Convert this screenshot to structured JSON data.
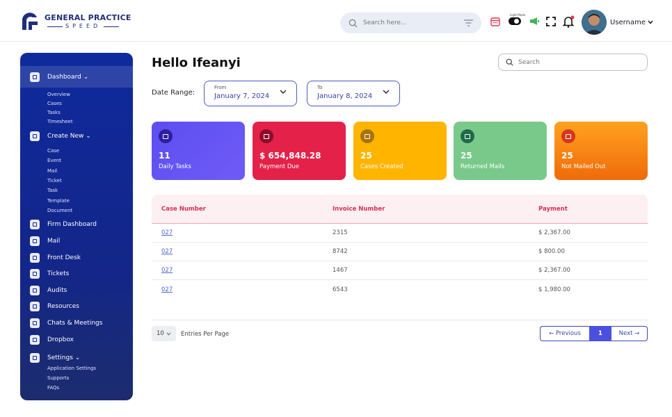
{
  "header": {
    "brand_name": "GENERAL PRACTICE",
    "brand_sub": "SPEED",
    "search_placeholder": "Search here...",
    "theme_label": "Light Mode",
    "username": "Username"
  },
  "sidebar": {
    "dashboard": "Dashboard ⌄",
    "dashboard_sub": [
      "Overview",
      "Cases",
      "Tasks",
      "Timesheet"
    ],
    "create_new": "Create New ⌄",
    "create_sub": [
      "Case",
      "Event",
      "Mail",
      "Ticket",
      "Task",
      "Template",
      "Document"
    ],
    "items": [
      "Firm Dashboard",
      "Mail",
      "Front Desk",
      "Tickets",
      "Audits",
      "Resources",
      "Chats & Meetings",
      "Dropbox"
    ],
    "settings": "Settings ⌄",
    "settings_sub": [
      "Application Settings",
      "Supports",
      "FAQs"
    ]
  },
  "main": {
    "title": "Hello Ifeanyi",
    "search_placeholder": "Search",
    "date_range_label": "Date Range:",
    "from_label": "From",
    "from_value": "January 7, 2024",
    "to_label": "To",
    "to_value": "January 8, 2024"
  },
  "cards": [
    {
      "value": "11",
      "label": "Daily Tasks",
      "color": "#5b5bf0"
    },
    {
      "value": "$ 654,848.28",
      "label": "Payment Due",
      "color": "#e32149"
    },
    {
      "value": "25",
      "label": "Cases Created",
      "color": "#ffb400"
    },
    {
      "value": "25",
      "label": "Returned Mails",
      "color": "#79c98a"
    },
    {
      "value": "25",
      "label": "Not Mailed Out",
      "color": "#f57b10"
    }
  ],
  "table": {
    "headers": [
      "Case Number",
      "Invoice Number",
      "Payment"
    ],
    "rows": [
      [
        "027",
        "2315",
        "$ 2,367.00"
      ],
      [
        "027",
        "8742",
        "$ 800.00"
      ],
      [
        "027",
        "1467",
        "$ 2,367.00"
      ],
      [
        "027",
        "6543",
        "$ 1,980.00"
      ]
    ]
  },
  "pagination": {
    "per_page": "10",
    "per_page_label": "Entries Per Page",
    "previous": "← Previous",
    "page": "1",
    "next": "Next →"
  }
}
